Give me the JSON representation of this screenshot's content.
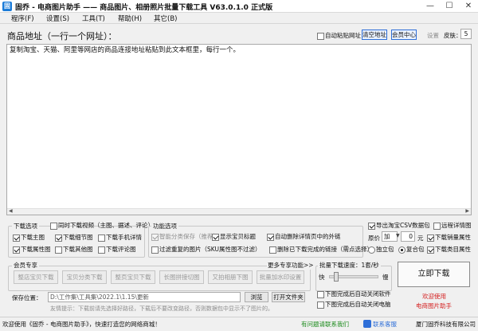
{
  "window": {
    "title": "固乔 - 电商图片助手 —— 商品图片、相册照片批量下载工具 V63.0.1.0 正式版",
    "app_icon": "固",
    "controls": [
      "—",
      "☐",
      "✕"
    ]
  },
  "menu": [
    {
      "label": "程序(F)"
    },
    {
      "label": "设置(S)"
    },
    {
      "label": "工具(T)"
    },
    {
      "label": "帮助(H)"
    },
    {
      "label": "其它(B)"
    }
  ],
  "url_bar": {
    "label": "商品地址（一行一个网址）：",
    "auto_paste_label": "自动粘贴网址",
    "clear_label": "清空地址",
    "member_label": "会员中心",
    "settings_label": "设置",
    "skin_label": "皮肤：",
    "skin_value": "5"
  },
  "textarea": {
    "placeholder_text": "复制淘宝、天猫、阿里等网店的商品连接地址粘贴到此文本框里，每行一个。"
  },
  "download_options": {
    "title": "下载选项",
    "sync_label": "同时下载视频（主图、据述、评论）",
    "items": [
      {
        "label": "下载主图",
        "checked": true
      },
      {
        "label": "下载细节图",
        "checked": true
      },
      {
        "label": "下载手机详情",
        "checked": false
      },
      {
        "label": "下载属性图",
        "checked": true
      },
      {
        "label": "下载其他图",
        "checked": false
      },
      {
        "label": "下载评论图",
        "checked": false
      }
    ]
  },
  "function_options": {
    "title": "功能选项",
    "smart_label": "智能分类保存（推荐）",
    "show_title_label": "显示宝贝标题",
    "auto_delete_label": "自动删除详情页中的外链",
    "filter_label": "过滤重复的图片（SKU属性图不过滤）",
    "delete_links_label": "删除已下载完成的链接（需点选择）"
  },
  "right_options": {
    "csv_label": "导出淘宝CSV数据包",
    "select_detail_label": "远程详情图",
    "price_label": "原价",
    "price_op": "加",
    "price_value": "0",
    "price_unit": "元",
    "download_sales_label": "下载销量属性",
    "standalone_label": "独立包",
    "compound_label": "复合包",
    "download_category_label": "下载类目属性"
  },
  "member": {
    "title": "会员专享",
    "more_label": "更多专享功能>>",
    "buttons": [
      "整店宝贝下载",
      "宝贝分类下载",
      "整页宝贝下载",
      "长图拼接切图",
      "又拍相册下图",
      "批量加水印设置"
    ]
  },
  "speed": {
    "title": "批量下载速度：1套/秒",
    "fast_label": "快",
    "slow_label": "慢",
    "level": 0.1,
    "close_app_label": "下图完成后自动关闭软件",
    "shutdown_label": "下图完成后自动关闭电脑"
  },
  "save": {
    "label": "保存位置：",
    "path": "D:\\工作集\\工具集\\2022.1\\1.15\\更新",
    "browse_label": "浏览",
    "open_folder_label": "打开文件夹",
    "tip": "友情提示：下载前请先选择好路径，下载后不要改变路径，否则数据包中显示不了图片的。"
  },
  "download_button": "立即下载",
  "welcome": {
    "line1": "欢迎使用",
    "line2": "电商图片助手"
  },
  "status": {
    "welcome_text": "欢迎使用《固乔 - 电商图片助手》，快速打造您的网络商城！",
    "question_text": "有问题请联系我们",
    "contact_label": "联系客服",
    "company_text": "厦门固乔科技有限公司"
  },
  "colors": {
    "accent_blue": "#2f6fd8",
    "red": "#d42020",
    "green": "#1a8a1a"
  }
}
